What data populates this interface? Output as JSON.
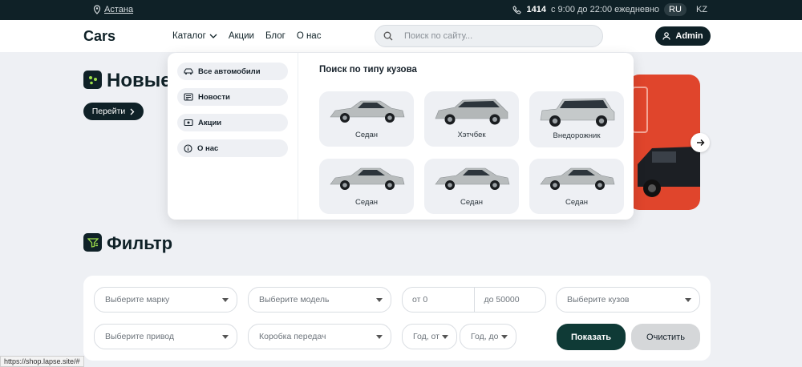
{
  "topbar": {
    "city": "Астана",
    "phone": "1414",
    "hours": "с 9:00 до 22:00 ежедневно",
    "lang_active": "RU",
    "lang_other": "KZ"
  },
  "header": {
    "logo": "Cars",
    "nav": [
      "Каталог",
      "Акции",
      "Блог",
      "О нас"
    ],
    "search_placeholder": "Поиск по сайту...",
    "admin_label": "Admin"
  },
  "hero": {
    "title": "Новые",
    "button": "Перейти"
  },
  "dropdown": {
    "menu": [
      "Все автомобили",
      "Новости",
      "Акции",
      "О нас"
    ],
    "title": "Поиск по типу кузова",
    "body_types": [
      "Седан",
      "Хэтчбек",
      "Внедорожник",
      "Седан",
      "Седан",
      "Седан"
    ]
  },
  "filter": {
    "title": "Фильтр",
    "brand": "Выберите марку",
    "model": "Выберите модель",
    "price_from": "от 0",
    "price_to": "до 50000",
    "body": "Выберите кузов",
    "drive": "Выберите привод",
    "gearbox": "Коробка передач",
    "year_from": "Год, от",
    "year_to": "Год, до",
    "show": "Показать",
    "clear": "Очистить"
  },
  "status_url": "https://shop.lapse.site/#",
  "colors": {
    "dark": "#0f2127",
    "accent_green": "#9ee04b",
    "promo_red": "#e0452c",
    "show_button": "#0f3a36"
  }
}
